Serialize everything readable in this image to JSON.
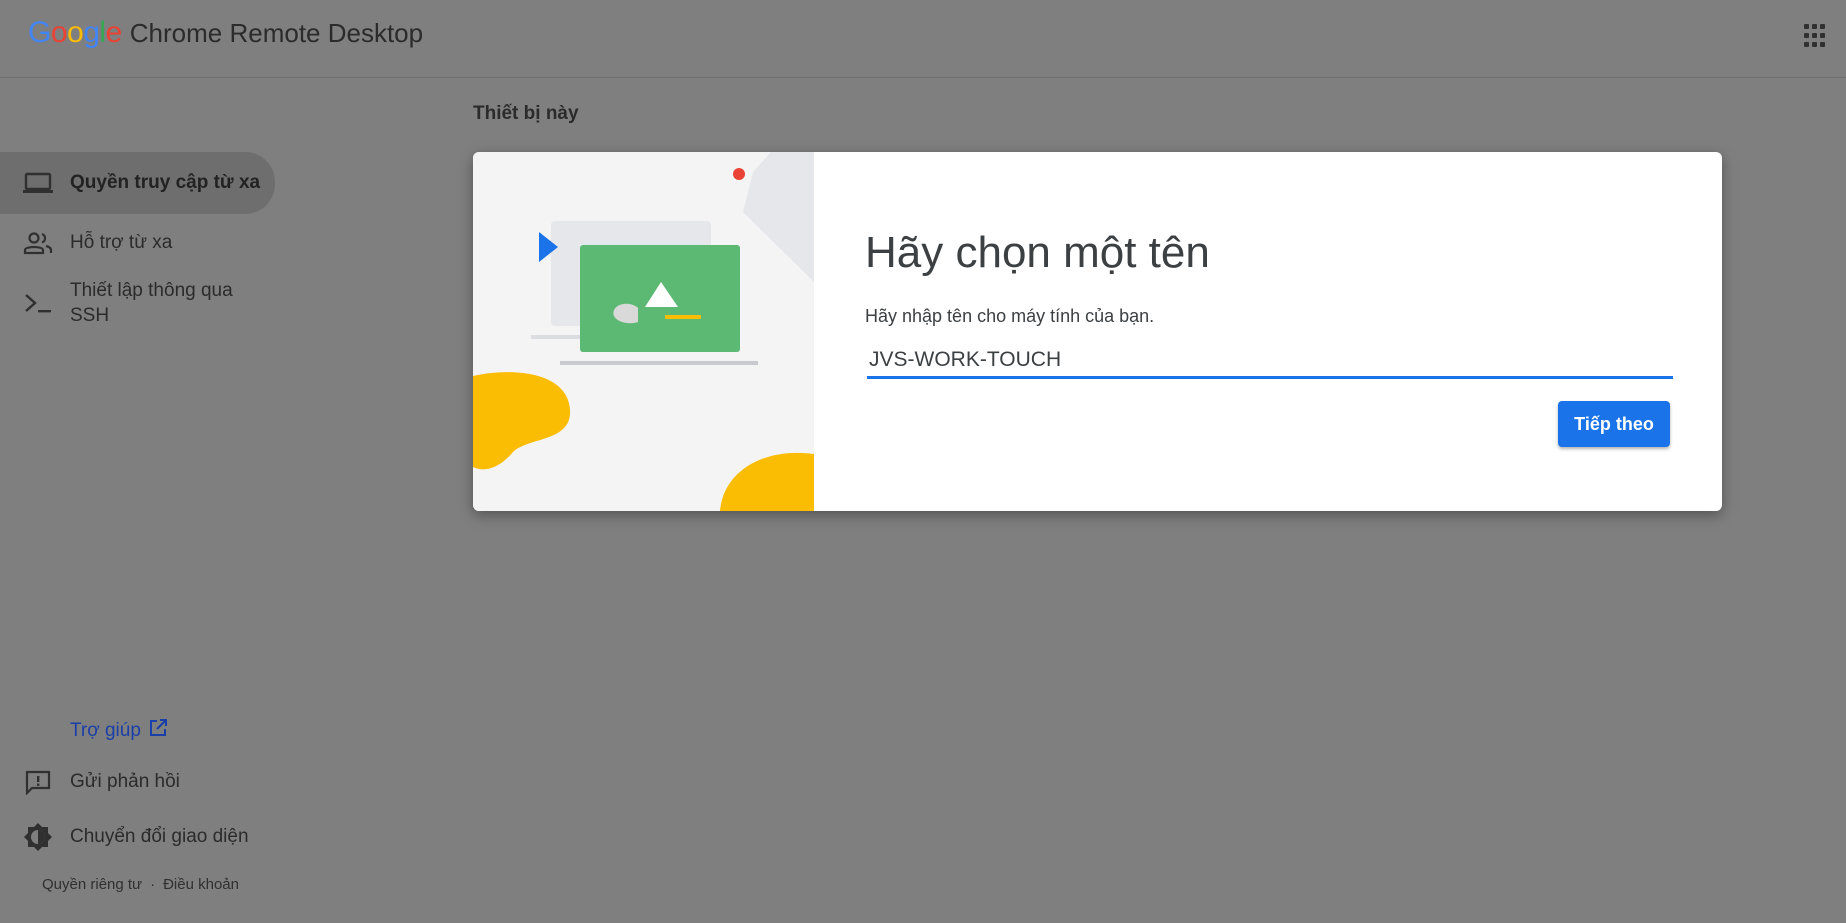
{
  "header": {
    "brand_google": [
      "G",
      "o",
      "o",
      "g",
      "l",
      "e"
    ],
    "brand_colors": [
      "#4285F4",
      "#EA4335",
      "#FBBC05",
      "#4285F4",
      "#34A853",
      "#EA4335"
    ],
    "product_name": "Chrome Remote Desktop",
    "apps_icon": "apps-grid-icon"
  },
  "sidebar": {
    "items": [
      {
        "label": "Quyền truy cập từ xa",
        "icon": "laptop-icon",
        "active": true
      },
      {
        "label": "Hỗ trợ từ xa",
        "icon": "people-icon",
        "active": false
      },
      {
        "label": "Thiết lập thông qua SSH",
        "label_line1": "Thiết lập thông qua",
        "label_line2": "SSH",
        "icon": "terminal-icon",
        "active": false
      }
    ],
    "help_label": "Trợ giúp",
    "feedback_label": "Gửi phản hồi",
    "theme_label": "Chuyển đổi giao diện",
    "footer": {
      "privacy": "Quyền riêng tư",
      "separator": "·",
      "terms": "Điều khoản"
    }
  },
  "main": {
    "section_title": "Thiết bị này",
    "dialog": {
      "title": "Hãy chọn một tên",
      "description": "Hãy nhập tên cho máy tính của bạn.",
      "input_value": "JVS-WORK-TOUCH",
      "next_label": "Tiếp theo"
    }
  },
  "colors": {
    "accent": "#1a73e8",
    "backdrop": "#7f7f7f",
    "illustration_green": "#5bb974",
    "illustration_yellow": "#fbbc04",
    "illustration_red": "#ea4335"
  }
}
